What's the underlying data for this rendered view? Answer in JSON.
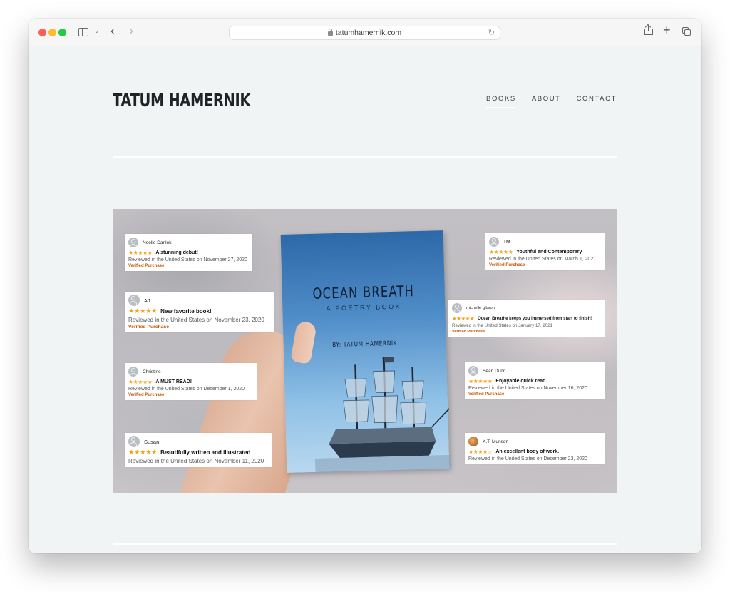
{
  "browser": {
    "url": "tatumhamernik.com",
    "icons": [
      "sidebar-icon",
      "chevron-down-icon",
      "back-icon",
      "forward-icon",
      "lock-icon",
      "reload-icon",
      "share-icon",
      "plus-icon",
      "tabs-icon"
    ]
  },
  "site": {
    "title": "TATUM HAMERNIK",
    "nav": [
      {
        "label": "BOOKS",
        "active": true
      },
      {
        "label": "ABOUT",
        "active": false
      },
      {
        "label": "CONTACT",
        "active": false
      }
    ]
  },
  "hero": {
    "book": {
      "title": "OCEAN BREATH",
      "subtitle": "A POETRY BOOK",
      "author": "BY: TATUM HAMERNIK"
    },
    "reviews": [
      {
        "name": "Noelle Darilek",
        "stars": "★★★★★",
        "rating": 5,
        "headline": "A stunning debut!",
        "meta": "Reviewed in the United States on November 27, 2020",
        "verified": "Verified Purchase"
      },
      {
        "name": "AJ",
        "stars": "★★★★★",
        "rating": 5,
        "headline": "New favorite book!",
        "meta": "Reviewed in the United States on November 23, 2020",
        "verified": "Verified Purchase"
      },
      {
        "name": "Christine",
        "stars": "★★★★★",
        "rating": 5,
        "headline": "A MUST READ!",
        "meta": "Reviewed in the United States on December 1, 2020",
        "verified": "Verified Purchase"
      },
      {
        "name": "Susan",
        "stars": "★★★★★",
        "rating": 5,
        "headline": "Beautifully written and illustrated",
        "meta": "Reviewed in the United States on November 11, 2020",
        "verified": ""
      },
      {
        "name": "TM",
        "stars": "★★★★★",
        "rating": 5,
        "headline": "Youthful and Contemporary",
        "meta": "Reviewed in the United States on March 1, 2021",
        "verified": "Verified Purchase"
      },
      {
        "name": "michelle gibson",
        "stars": "★★★★★",
        "rating": 5,
        "headline": "Ocean Breathe keeps you immersed from start to finish!",
        "meta": "Reviewed in the United States on January 17, 2021",
        "verified": "Verified Purchase"
      },
      {
        "name": "Sean Dunn",
        "stars": "★★★★★",
        "rating": 5,
        "headline": "Enjoyable quick read.",
        "meta": "Reviewed in the United States on November 16, 2020",
        "verified": "Verified Purchase"
      },
      {
        "name": "K.T. Munson",
        "stars": "★★★★☆",
        "rating": 4,
        "headline": "An excellent body of work.",
        "meta": "Reviewed in the United States on December 23, 2020",
        "verified": ""
      }
    ]
  },
  "glyphs": {
    "chevron_down": "⌄",
    "back": "‹",
    "forward": "›",
    "reload": "↻",
    "plus": "+"
  }
}
